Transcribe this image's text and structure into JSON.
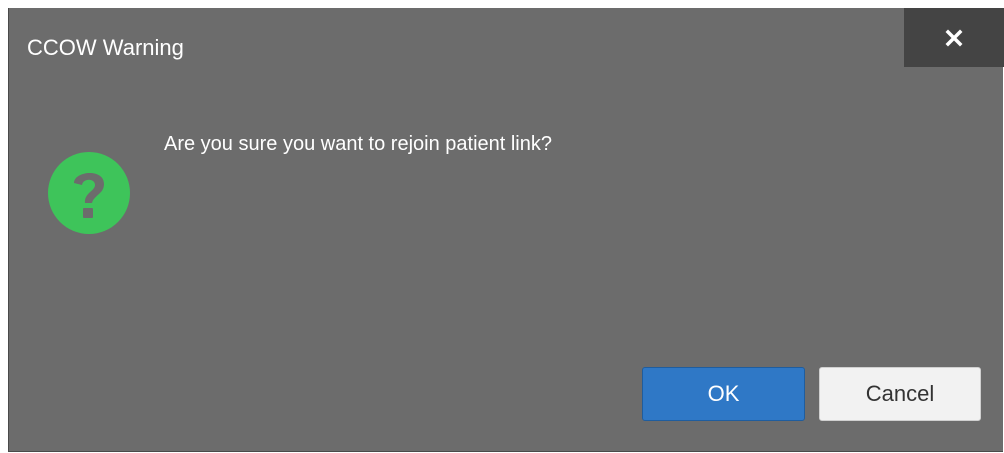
{
  "dialog": {
    "title": "CCOW Warning",
    "close_icon": "close-icon",
    "message": "Are you sure you want to rejoin patient link?",
    "icon": "question-icon",
    "ok_label": "OK",
    "cancel_label": "Cancel"
  },
  "colors": {
    "dialog_background": "#6c6c6c",
    "title_bar_close_background": "#444444",
    "question_icon": "#3ec45a",
    "ok_button": "#2f78c6",
    "cancel_button": "#f2f2f2"
  }
}
